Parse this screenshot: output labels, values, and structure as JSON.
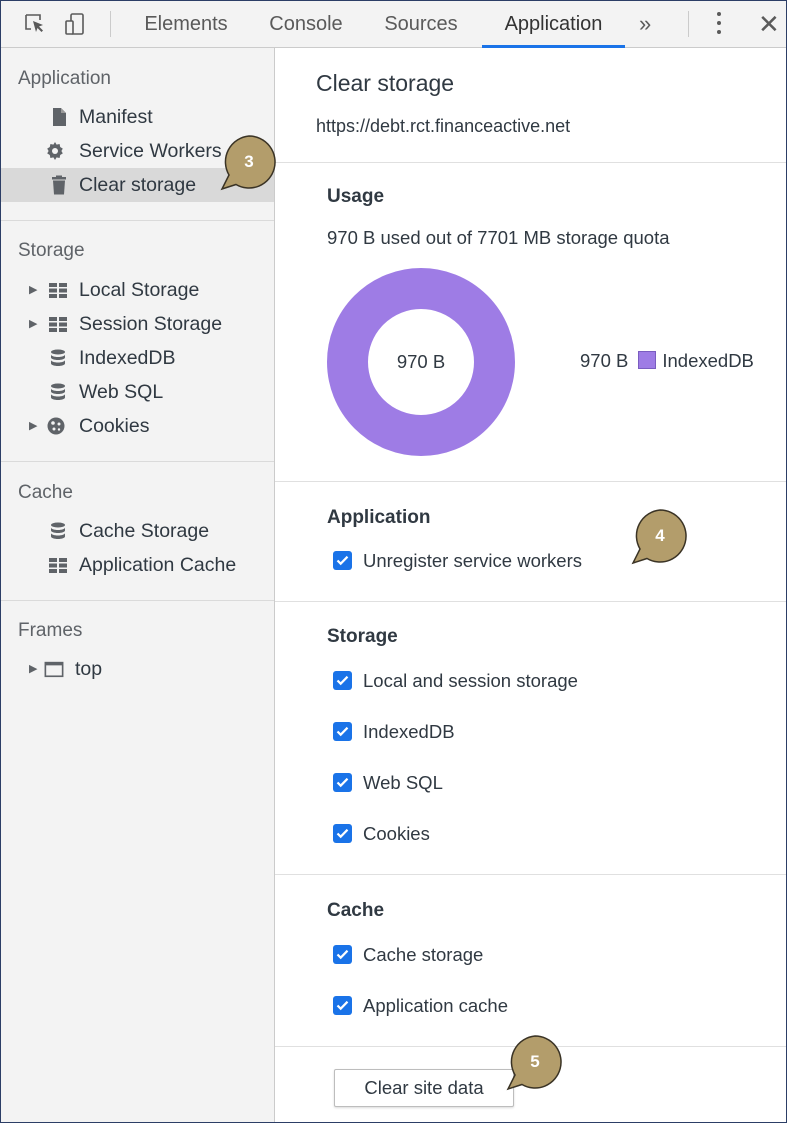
{
  "toolbar": {
    "tabs": [
      {
        "label": "Elements"
      },
      {
        "label": "Console"
      },
      {
        "label": "Sources"
      },
      {
        "label": "Application"
      }
    ],
    "overflow": "»",
    "close": "✕",
    "active_tab": "Application",
    "accent_color": "#1a73e8"
  },
  "sidebar": {
    "application": {
      "title": "Application",
      "items": [
        {
          "label": "Manifest",
          "icon": "file-icon"
        },
        {
          "label": "Service Workers",
          "icon": "gear-icon"
        },
        {
          "label": "Clear storage",
          "icon": "trash-icon",
          "selected": true
        }
      ]
    },
    "storage": {
      "title": "Storage",
      "items": [
        {
          "label": "Local Storage",
          "icon": "grid-icon"
        },
        {
          "label": "Session Storage",
          "icon": "grid-icon"
        },
        {
          "label": "IndexedDB",
          "icon": "database-icon"
        },
        {
          "label": "Web SQL",
          "icon": "database-icon"
        },
        {
          "label": "Cookies",
          "icon": "cookie-icon"
        }
      ]
    },
    "cache": {
      "title": "Cache",
      "items": [
        {
          "label": "Cache Storage",
          "icon": "database-icon"
        },
        {
          "label": "Application Cache",
          "icon": "grid-icon"
        }
      ]
    },
    "frames": {
      "title": "Frames",
      "items": [
        {
          "label": "top",
          "icon": "frame-icon"
        }
      ]
    }
  },
  "main": {
    "title": "Clear storage",
    "url": "https://debt.rct.financeactive.net",
    "usage": {
      "heading": "Usage",
      "summary": "970 B used out of 7701 MB storage quota",
      "donut_center": "970 B",
      "legend_value": "970 B",
      "legend_label": "IndexedDB",
      "donut_color": "#9e7ce5"
    },
    "application": {
      "heading": "Application",
      "options": [
        {
          "label": "Unregister service workers",
          "checked": true
        }
      ]
    },
    "storage": {
      "heading": "Storage",
      "options": [
        {
          "label": "Local and session storage",
          "checked": true
        },
        {
          "label": "IndexedDB",
          "checked": true
        },
        {
          "label": "Web SQL",
          "checked": true
        },
        {
          "label": "Cookies",
          "checked": true
        }
      ]
    },
    "cache": {
      "heading": "Cache",
      "options": [
        {
          "label": "Cache storage",
          "checked": true
        },
        {
          "label": "Application cache",
          "checked": true
        }
      ]
    },
    "clear_button": "Clear site data"
  },
  "callouts": [
    {
      "number": "3"
    },
    {
      "number": "4"
    },
    {
      "number": "5"
    }
  ],
  "callout_color": "#b39d6b"
}
